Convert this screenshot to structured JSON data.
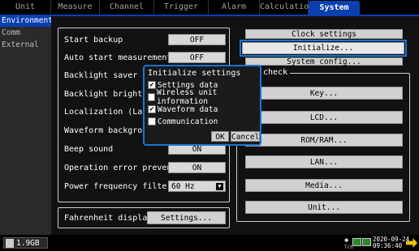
{
  "tabs": [
    "Unit",
    "Measure",
    "Channel",
    "Trigger",
    "Alarm",
    "Calculation",
    "System"
  ],
  "sidebar": [
    "Environment",
    "Comm",
    "External"
  ],
  "settings": {
    "start_backup": {
      "label": "Start backup",
      "value": "OFF"
    },
    "auto_start": {
      "label": "Auto start measurement",
      "value": "OFF"
    },
    "backlight_saver": {
      "label": "Backlight saver"
    },
    "backlight_brightness": {
      "label": "Backlight brightness"
    },
    "localization": {
      "label": "Localization (Language)"
    },
    "waveform_bg": {
      "label": "Waveform background color"
    },
    "beep": {
      "label": "Beep sound",
      "value": "ON"
    },
    "op_error": {
      "label": "Operation error prevention",
      "value": "ON"
    },
    "power_freq": {
      "label": "Power frequency filter",
      "value": "60 Hz"
    },
    "fahrenheit": {
      "label": "Fahrenheit display",
      "button": "Settings..."
    }
  },
  "right": {
    "clock": "Clock settings",
    "initialize": "Initialize...",
    "system_config": "System config...",
    "check_label": "check",
    "key": "Key...",
    "lcd": "LCD...",
    "romram": "ROM/RAM...",
    "lan": "LAN...",
    "media": "Media...",
    "unit": "Unit..."
  },
  "dialog": {
    "title": "Initialize settings",
    "items": [
      {
        "label": "Settings data",
        "checked": true
      },
      {
        "label": "Wireless unit information",
        "checked": false
      },
      {
        "label": "Waveform data",
        "checked": true
      },
      {
        "label": "Communication",
        "checked": false
      }
    ],
    "ok": "OK",
    "cancel": "Cancel"
  },
  "status": {
    "drive": "1.9GB",
    "tch": "Tch",
    "date": "2020-09-24",
    "time": "09:36:40"
  },
  "colors": {
    "accent": "#0a3fb0",
    "highlight": "#1b73d6",
    "checkmark": "#f3c20a"
  }
}
